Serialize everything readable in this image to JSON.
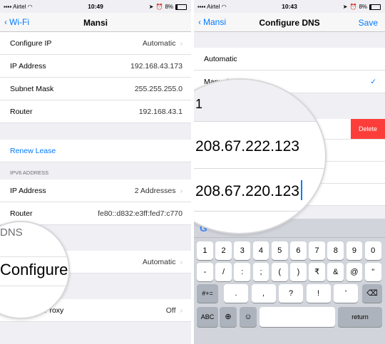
{
  "left": {
    "status": {
      "carrier": "Airtel",
      "time": "10:49",
      "battery": "8%"
    },
    "nav": {
      "back": "Wi-Fi",
      "title": "Mansi"
    },
    "rows": [
      {
        "label": "Configure IP",
        "value": "Automatic"
      },
      {
        "label": "IP Address",
        "value": "192.168.43.173"
      },
      {
        "label": "Subnet Mask",
        "value": "255.255.255.0"
      },
      {
        "label": "Router",
        "value": "192.168.43.1"
      }
    ],
    "renew": "Renew Lease",
    "ipv6_header": "IPV6 ADDRESS",
    "ipv6_rows": [
      {
        "label": "IP Address",
        "value": "2 Addresses"
      },
      {
        "label": "Router",
        "value": "fe80::d832:e3ff:fed7:c770"
      }
    ],
    "dns_header": "DNS",
    "configure_dns_value": "Automatic",
    "magnified_dns": "DNS",
    "magnified_configure": "Configure",
    "proxy": {
      "label": "Configure Proxy",
      "value": "Off"
    }
  },
  "right": {
    "status": {
      "carrier": "Airtel",
      "time": "10:43",
      "battery": "8%"
    },
    "nav": {
      "back": "Mansi",
      "title": "Configure DNS",
      "save": "Save"
    },
    "automatic": "Automatic",
    "manual": "Manual",
    "partial_server": "1",
    "delete": "Delete",
    "dns_servers": [
      "208.67.222.123",
      "208.67.220.123"
    ],
    "keys_row1": [
      "1",
      "2",
      "3",
      "4",
      "5",
      "6",
      "7",
      "8",
      "9",
      "0"
    ],
    "keys_row2": [
      "-",
      "/",
      ":",
      ";",
      "(",
      ")",
      "₹",
      "&",
      "@",
      "\""
    ],
    "keys_row3_left": "#+=",
    "keys_row3": [
      ".",
      ",",
      "?",
      "!",
      "'"
    ],
    "key_abc": "ABC",
    "key_return": "return"
  }
}
